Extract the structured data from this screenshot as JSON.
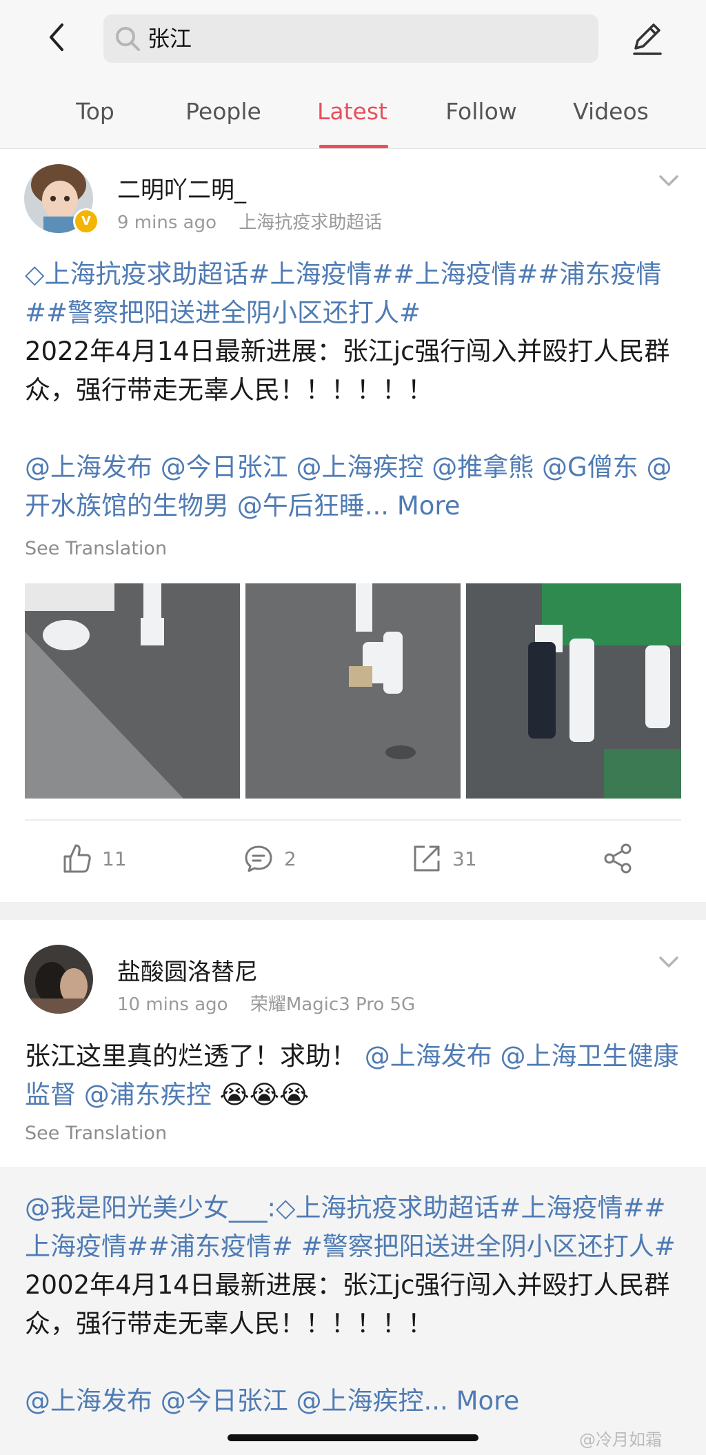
{
  "header": {
    "search_value": "张江",
    "tabs": [
      "Top",
      "People",
      "Latest",
      "Follow",
      "Videos"
    ],
    "active_tab": "Latest"
  },
  "post1": {
    "username": "二明吖二明_",
    "time": "9 mins ago",
    "source": "上海抗疫求助超话",
    "tags_line": "上海抗疫求助超话#上海疫情##上海疫情##浦东疫情##警察把阳送进全阴小区还打人#",
    "text": "2022年4月14日最新进展：张江jc强行闯入并殴打人民群众，强行带走无辜人民！！！！！！",
    "mentions": "@上海发布 @今日张江 @上海疾控 @推拿熊 @G僧东 @开水族馆的生物男 @午后狂睡...",
    "more": "More",
    "see_translation": "See Translation",
    "likes": "11",
    "comments": "2",
    "reposts": "31"
  },
  "post2": {
    "username": "盐酸圆洛替尼",
    "time": "10 mins ago",
    "source": "荣耀Magic3 Pro 5G",
    "text_plain": "张江这里真的烂透了！求助！",
    "text_mentions": "@上海发布 @上海卫生健康监督 @浦东疾控",
    "emoji": "😭😭😭",
    "see_translation": "See Translation",
    "quote_user": "@我是阳光美少女___:",
    "quote_tags": "上海抗疫求助超话#上海疫情##上海疫情##浦东疫情# #警察把阳送进全阴小区还打人#",
    "quote_text": "2002年4月14日最新进展：张江jc强行闯入并殴打人民群众，强行带走无辜人民！！！！！！",
    "quote_mentions": "@上海发布 @今日张江 @上海疾控...",
    "quote_more": "More"
  },
  "watermark": "@冷月如霜",
  "colors": {
    "accent": "#e8505b",
    "link": "#4f7bb4"
  }
}
